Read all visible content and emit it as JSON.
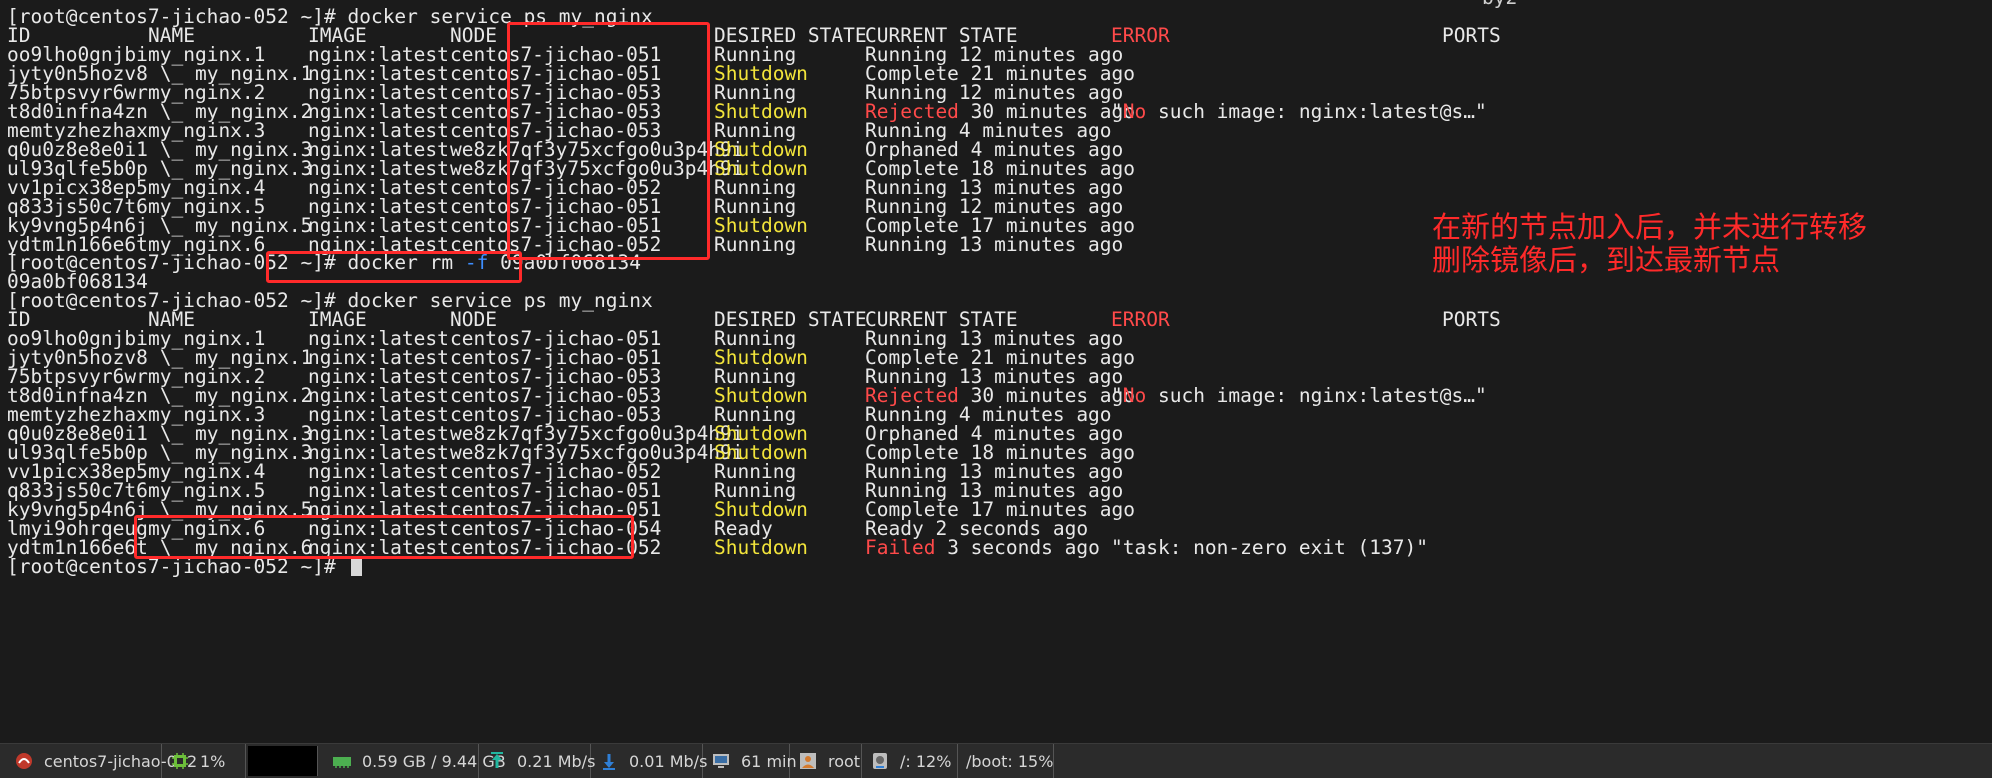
{
  "partial_top_text": "by2",
  "headers": {
    "id": "ID",
    "name": "NAME",
    "image": "IMAGE",
    "node": "NODE",
    "desired": "DESIRED STATE",
    "current": "CURRENT STATE",
    "error": "ERROR",
    "ports": "PORTS"
  },
  "prompt": "[root@centos7-jichao-052 ~]# ",
  "commands": {
    "ps": "docker service ps my_nginx",
    "rm_prefix": "docker rm ",
    "rm_flag": "-f",
    "rm_arg": " 09a0bf068134",
    "rm_output": "09a0bf068134"
  },
  "table1": [
    {
      "id": "oo9lho0gnjbi",
      "name": "my_nginx.1",
      "image": "nginx:latest",
      "node": "centos7-jichao-051",
      "desired": "Running",
      "cur_a": "",
      "cur_b": "Running 12 minutes ago",
      "err_q1": "",
      "err_red": "",
      "err_rest": ""
    },
    {
      "id": "jyty0n5hozv8",
      "name": " \\_ my_nginx.1",
      "image": "nginx:latest",
      "node": "centos7-jichao-051",
      "desired": "Shutdown",
      "cur_a": "",
      "cur_b": "Complete 21 minutes ago",
      "err_q1": "",
      "err_red": "",
      "err_rest": ""
    },
    {
      "id": "75btpsvyr6wr",
      "name": "my_nginx.2",
      "image": "nginx:latest",
      "node": "centos7-jichao-053",
      "desired": "Running",
      "cur_a": "",
      "cur_b": "Running 12 minutes ago",
      "err_q1": "",
      "err_red": "",
      "err_rest": ""
    },
    {
      "id": "t8d0infna4zn",
      "name": " \\_ my_nginx.2",
      "image": "nginx:latest",
      "node": "centos7-jichao-053",
      "desired": "Shutdown",
      "cur_a": "Rejected",
      "cur_b": " 30 minutes ago",
      "err_q1": "\"",
      "err_red": "No",
      "err_rest": " such image: nginx:latest@s…\""
    },
    {
      "id": "memtyzhezhax",
      "name": "my_nginx.3",
      "image": "nginx:latest",
      "node": "centos7-jichao-053",
      "desired": "Running",
      "cur_a": "",
      "cur_b": "Running 4 minutes ago",
      "err_q1": "",
      "err_red": "",
      "err_rest": ""
    },
    {
      "id": "q0u0z8e8e0i1",
      "name": " \\_ my_nginx.3",
      "image": "nginx:latest",
      "node": "we8zk7qf3y75xcfgo0u3p4h9i",
      "desired": "Shutdown",
      "cur_a": "",
      "cur_b": "Orphaned 4 minutes ago",
      "err_q1": "",
      "err_red": "",
      "err_rest": ""
    },
    {
      "id": "ul93qlfe5b0p",
      "name": " \\_ my_nginx.3",
      "image": "nginx:latest",
      "node": "we8zk7qf3y75xcfgo0u3p4h9i",
      "desired": "Shutdown",
      "cur_a": "",
      "cur_b": "Complete 18 minutes ago",
      "err_q1": "",
      "err_red": "",
      "err_rest": ""
    },
    {
      "id": "vv1picx38ep5",
      "name": "my_nginx.4",
      "image": "nginx:latest",
      "node": "centos7-jichao-052",
      "desired": "Running",
      "cur_a": "",
      "cur_b": "Running 13 minutes ago",
      "err_q1": "",
      "err_red": "",
      "err_rest": ""
    },
    {
      "id": "q833js50c7t6",
      "name": "my_nginx.5",
      "image": "nginx:latest",
      "node": "centos7-jichao-051",
      "desired": "Running",
      "cur_a": "",
      "cur_b": "Running 12 minutes ago",
      "err_q1": "",
      "err_red": "",
      "err_rest": ""
    },
    {
      "id": "ky9vng5p4n6j",
      "name": " \\_ my_nginx.5",
      "image": "nginx:latest",
      "node": "centos7-jichao-051",
      "desired": "Shutdown",
      "cur_a": "",
      "cur_b": "Complete 17 minutes ago",
      "err_q1": "",
      "err_red": "",
      "err_rest": ""
    },
    {
      "id": "ydtm1n166e6t",
      "name": "my_nginx.6",
      "image": "nginx:latest",
      "node": "centos7-jichao-052",
      "desired": "Running",
      "cur_a": "",
      "cur_b": "Running 13 minutes ago",
      "err_q1": "",
      "err_red": "",
      "err_rest": ""
    }
  ],
  "table2": [
    {
      "id": "oo9lho0gnjbi",
      "name": "my_nginx.1",
      "image": "nginx:latest",
      "node": "centos7-jichao-051",
      "desired": "Running",
      "cur_a": "",
      "cur_b": "Running 13 minutes ago",
      "err_q1": "",
      "err_red": "",
      "err_rest": ""
    },
    {
      "id": "jyty0n5hozv8",
      "name": " \\_ my_nginx.1",
      "image": "nginx:latest",
      "node": "centos7-jichao-051",
      "desired": "Shutdown",
      "cur_a": "",
      "cur_b": "Complete 21 minutes ago",
      "err_q1": "",
      "err_red": "",
      "err_rest": ""
    },
    {
      "id": "75btpsvyr6wr",
      "name": "my_nginx.2",
      "image": "nginx:latest",
      "node": "centos7-jichao-053",
      "desired": "Running",
      "cur_a": "",
      "cur_b": "Running 13 minutes ago",
      "err_q1": "",
      "err_red": "",
      "err_rest": ""
    },
    {
      "id": "t8d0infna4zn",
      "name": " \\_ my_nginx.2",
      "image": "nginx:latest",
      "node": "centos7-jichao-053",
      "desired": "Shutdown",
      "cur_a": "Rejected",
      "cur_b": " 30 minutes ago",
      "err_q1": "\"",
      "err_red": "No",
      "err_rest": " such image: nginx:latest@s…\""
    },
    {
      "id": "memtyzhezhax",
      "name": "my_nginx.3",
      "image": "nginx:latest",
      "node": "centos7-jichao-053",
      "desired": "Running",
      "cur_a": "",
      "cur_b": "Running 4 minutes ago",
      "err_q1": "",
      "err_red": "",
      "err_rest": ""
    },
    {
      "id": "q0u0z8e8e0i1",
      "name": " \\_ my_nginx.3",
      "image": "nginx:latest",
      "node": "we8zk7qf3y75xcfgo0u3p4h9i",
      "desired": "Shutdown",
      "cur_a": "",
      "cur_b": "Orphaned 4 minutes ago",
      "err_q1": "",
      "err_red": "",
      "err_rest": ""
    },
    {
      "id": "ul93qlfe5b0p",
      "name": " \\_ my_nginx.3",
      "image": "nginx:latest",
      "node": "we8zk7qf3y75xcfgo0u3p4h9i",
      "desired": "Shutdown",
      "cur_a": "",
      "cur_b": "Complete 18 minutes ago",
      "err_q1": "",
      "err_red": "",
      "err_rest": ""
    },
    {
      "id": "vv1picx38ep5",
      "name": "my_nginx.4",
      "image": "nginx:latest",
      "node": "centos7-jichao-052",
      "desired": "Running",
      "cur_a": "",
      "cur_b": "Running 13 minutes ago",
      "err_q1": "",
      "err_red": "",
      "err_rest": ""
    },
    {
      "id": "q833js50c7t6",
      "name": "my_nginx.5",
      "image": "nginx:latest",
      "node": "centos7-jichao-051",
      "desired": "Running",
      "cur_a": "",
      "cur_b": "Running 13 minutes ago",
      "err_q1": "",
      "err_red": "",
      "err_rest": ""
    },
    {
      "id": "ky9vng5p4n6j",
      "name": " \\_ my_nginx.5",
      "image": "nginx:latest",
      "node": "centos7-jichao-051",
      "desired": "Shutdown",
      "cur_a": "",
      "cur_b": "Complete 17 minutes ago",
      "err_q1": "",
      "err_red": "",
      "err_rest": ""
    },
    {
      "id": "lmyi9ohrqeug",
      "name": "my_nginx.6",
      "image": "nginx:latest",
      "node": "centos7-jichao-054",
      "desired": "Ready",
      "cur_a": "",
      "cur_b": "Ready 2 seconds ago",
      "err_q1": "",
      "err_red": "",
      "err_rest": ""
    },
    {
      "id": "ydtm1n166e6t",
      "name": " \\_ my_nginx.6",
      "image": "nginx:latest",
      "node": "centos7-jichao-052",
      "desired": "Shutdown",
      "cur_a": "Failed",
      "cur_b": " 3 seconds ago",
      "err_q1": "",
      "err_red": "",
      "err_rest": "\"task: non-zero exit (137)\""
    }
  ],
  "annotation": {
    "line1": "在新的节点加入后，并未进行转移",
    "line2": "删除镜像后，到达最新节点"
  },
  "status_bar": {
    "host": "centos7-jichao-052",
    "cpu": "1%",
    "memory": "0.59 GB / 9.44 GB",
    "upload": "0.21 Mb/s",
    "download": "0.01 Mb/s",
    "uptime": "61 min",
    "user": "root",
    "disk_root": "/: 12%",
    "disk_boot": "/boot: 15%"
  },
  "colors": {
    "background": "#1b1b1b",
    "text": "#e8e8e8",
    "shutdown": "#f2e43b",
    "error_red": "#ff4a4a",
    "flag_blue": "#3d8eff",
    "annotation_red": "#ff2a2a"
  }
}
